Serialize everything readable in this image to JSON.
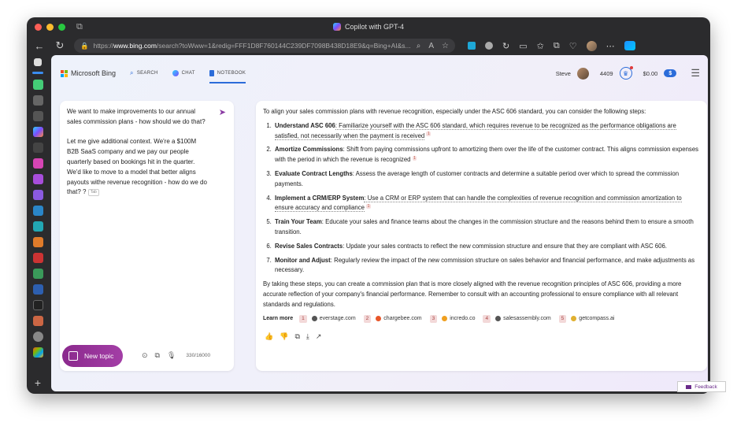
{
  "window": {
    "title": "Copilot with GPT-4"
  },
  "browser": {
    "url_host": "www.bing.com",
    "url_prefix": "https://",
    "url_rest": "/search?toWww=1&redig=FFF1D8F760144C239DF7098B438D18E9&q=Bing+AI&s..."
  },
  "header": {
    "logo_text": "Microsoft Bing",
    "tabs": [
      {
        "label": "SEARCH"
      },
      {
        "label": "CHAT"
      },
      {
        "label": "NOTEBOOK"
      }
    ],
    "user_name": "Steve",
    "points": "4409",
    "balance": "$0.00",
    "dollar_badge": "$"
  },
  "notebook": {
    "prompt_text": "We want to make improvements to our annual sales commission plans - how should we do that?\n\nLet me give additional context.  We're a $100M B2B SaaS company and we pay our people quarterly based on bookings hit in the quarter.  We'd like to move to a model that better aligns payouts withe revenue recognition - how do we do that? ?",
    "tab_hint": "Tab",
    "new_topic_label": "New topic",
    "char_count": "330/16000"
  },
  "response": {
    "intro": "To align your sales commission plans with revenue recognition, especially under the ASC 606 standard, you can consider the following steps:",
    "steps": [
      {
        "title": "Understand ASC 606",
        "text": ": Familiarize yourself with the ASC 606 standard, which requires revenue to be recognized as the performance obligations are satisfied, not necessarily when the payment is received",
        "cite": "1"
      },
      {
        "title": "Amortize Commissions",
        "text": ": Shift from paying commissions upfront to amortizing them over the life of the customer contract. This aligns commission expenses with the period in which the revenue is recognized",
        "cite": "1"
      },
      {
        "title": "Evaluate Contract Lengths",
        "text": ": Assess the average length of customer contracts and determine a suitable period over which to spread the commission payments.",
        "cite": ""
      },
      {
        "title": "Implement a CRM/ERP System",
        "text": ": Use a CRM or ERP system that can handle the complexities of revenue recognition and commission amortization to ensure accuracy and compliance",
        "cite": "1"
      },
      {
        "title": "Train Your Team",
        "text": ": Educate your sales and finance teams about the changes in the commission structure and the reasons behind them to ensure a smooth transition.",
        "cite": ""
      },
      {
        "title": "Revise Sales Contracts",
        "text": ": Update your sales contracts to reflect the new commission structure and ensure that they are compliant with ASC 606.",
        "cite": ""
      },
      {
        "title": "Monitor and Adjust",
        "text": ": Regularly review the impact of the new commission structure on sales behavior and financial performance, and make adjustments as necessary.",
        "cite": ""
      }
    ],
    "outro": "By taking these steps, you can create a commission plan that is more closely aligned with the revenue recognition principles of ASC 606, providing a more accurate reflection of your company's financial performance. Remember to consult with an accounting professional to ensure compliance with all relevant standards and regulations.",
    "learn_more_label": "Learn more",
    "sources": [
      {
        "num": "1",
        "domain": "everstage.com",
        "color": "#555555"
      },
      {
        "num": "2",
        "domain": "chargebee.com",
        "color": "#e8562a"
      },
      {
        "num": "3",
        "domain": "incredo.co",
        "color": "#f0a020"
      },
      {
        "num": "4",
        "domain": "salesassembly.com",
        "color": "#555555"
      },
      {
        "num": "5",
        "domain": "getcompass.ai",
        "color": "#e0b030"
      }
    ]
  },
  "feedback_label": "Feedback"
}
